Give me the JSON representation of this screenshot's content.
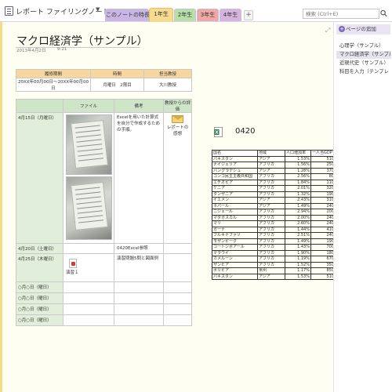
{
  "app": {
    "notebook_title": "レポート ファイリングノート",
    "sections": [
      "このノートの特長",
      "1年生",
      "2年生",
      "3年生",
      "4年生"
    ],
    "search_placeholder": "検索 (Ctrl+E)",
    "colors": {
      "active_tab": "#f7dc8f",
      "tab_purple": "#c9b6e4",
      "tab_green": "#b7e0a6",
      "tab_red": "#f2a7a7",
      "tab_violet": "#d6b4df"
    }
  },
  "page": {
    "title": "マクロ経済学（サンプル）",
    "date": "2013年4月2日",
    "time": "9:21"
  },
  "info_table": {
    "headers": [
      "履修期間",
      "時間",
      "担当教授"
    ],
    "row": [
      "20XX年00月00日～20XX年00月00日",
      "月曜日　2限目",
      "大川教授"
    ]
  },
  "main_table": {
    "headers": [
      "",
      "ファイル",
      "備考",
      "教授からの評価"
    ],
    "rows": [
      {
        "date": "4月15日（月曜日）",
        "note": "Excelを用いた計算式を自分で作成するための手順。",
        "eval": "レポートの感想"
      },
      {
        "date": "4月20日（土曜日）",
        "note": "0420Excel参照"
      },
      {
        "date": "4月25日（木曜日）",
        "file": "演習１",
        "note": "演習問題5問と図面例"
      },
      {
        "date": "○月○日（曜日）"
      },
      {
        "date": "○月○日（曜日）"
      },
      {
        "date": "○月○日（曜日）"
      },
      {
        "date": "○月○日（曜日）"
      }
    ]
  },
  "embedded_excel": {
    "label": "0420",
    "headers": [
      "国名",
      "地域",
      "人口増加率",
      "一人当GDP"
    ],
    "rows": [
      [
        "パキスタン",
        "アジア",
        "1.53%",
        "510"
      ],
      [
        "ナイジェリア",
        "アフリカ",
        "1.56%",
        "250"
      ],
      [
        "バングラデシュ",
        "アジア",
        "1.28%",
        "370"
      ],
      [
        "コンゴ民主主義共和国",
        "アフリカ",
        "2.56%",
        "80"
      ],
      [
        "エチオピア",
        "アフリカ",
        "1.84%",
        "110"
      ],
      [
        "ケニア",
        "アフリカ",
        "2.01%",
        "320"
      ],
      [
        "タンザニア",
        "アフリカ",
        "1.32%",
        "190"
      ],
      [
        "イエメン",
        "アジア",
        "2.43%",
        "310"
      ],
      [
        "ネパール",
        "アジア",
        "1.49%",
        "240"
      ],
      [
        "ニジェール",
        "アフリカ",
        "2.94%",
        "200"
      ],
      [
        "マダガスカル",
        "アフリカ",
        "2.00%",
        "240"
      ],
      [
        "マリ",
        "アフリカ",
        "2.60%",
        "240"
      ],
      [
        "ガーナ",
        "アフリカ",
        "1.44%",
        "410"
      ],
      [
        "ブルキナファソ",
        "アフリカ",
        "2.51%",
        "240"
      ],
      [
        "モザンビーク",
        "アフリカ",
        "1.49%",
        "190"
      ],
      [
        "コートジボアール",
        "アフリカ",
        "1.43%",
        "700"
      ],
      [
        "マラウイ",
        "アフリカ",
        "1.90%",
        "180"
      ],
      [
        "カメルーン",
        "アフリカ",
        "1.19%",
        "670"
      ],
      [
        "ザンビア",
        "アフリカ",
        "1.52%",
        "350"
      ],
      [
        "ボリビア",
        "米州",
        "1.17%",
        "850"
      ],
      [
        "パキスタン",
        "アジア",
        "1.53%",
        "510"
      ]
    ]
  },
  "right_panel": {
    "add_page": "ページの追加",
    "pages": [
      "心理学（サンプル）",
      "マクロ経済学（サンプル）",
      "近現代史（サンプル）",
      "科目を入力（テンプレ"
    ],
    "selected_index": 1
  }
}
